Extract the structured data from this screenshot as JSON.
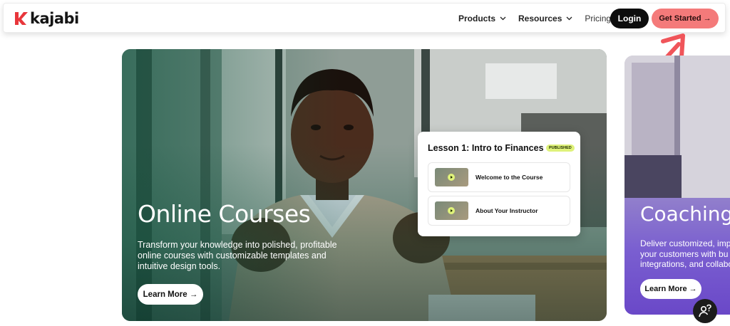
{
  "brand": {
    "name": "kajabi",
    "accent": "#f47a7a",
    "logo_red": "#e8363b"
  },
  "nav": {
    "items": [
      {
        "label": "Products",
        "icon": "chevron-down-icon"
      },
      {
        "label": "Resources",
        "icon": "chevron-down-icon"
      },
      {
        "label": "Pricing"
      }
    ],
    "login_label": "Login",
    "cta_label": "Get Started →"
  },
  "hero": {
    "title": "Online Courses",
    "description_lines": [
      "Transform your knowledge into polished, profitable",
      "online courses with customizable templates and",
      "intuitive design tools."
    ],
    "button_label": "Learn More →",
    "overlay_color": "#0c553e"
  },
  "lesson_panel": {
    "title": "Lesson 1: Intro to Finances",
    "badge": "PUBLISHED",
    "badge_color": "#dff27a",
    "items": [
      {
        "label": "Welcome to the Course",
        "icon": "play-icon"
      },
      {
        "label": "About Your Instructor",
        "icon": "play-icon"
      }
    ]
  },
  "side_card": {
    "title": "Coaching",
    "description_lines": [
      "Deliver customized, imp",
      "your customers with bu",
      "integrations, and collabo"
    ],
    "button_label": "Learn More →",
    "color": "#7a5fd0"
  },
  "help": {
    "icon": "help-person-icon"
  }
}
